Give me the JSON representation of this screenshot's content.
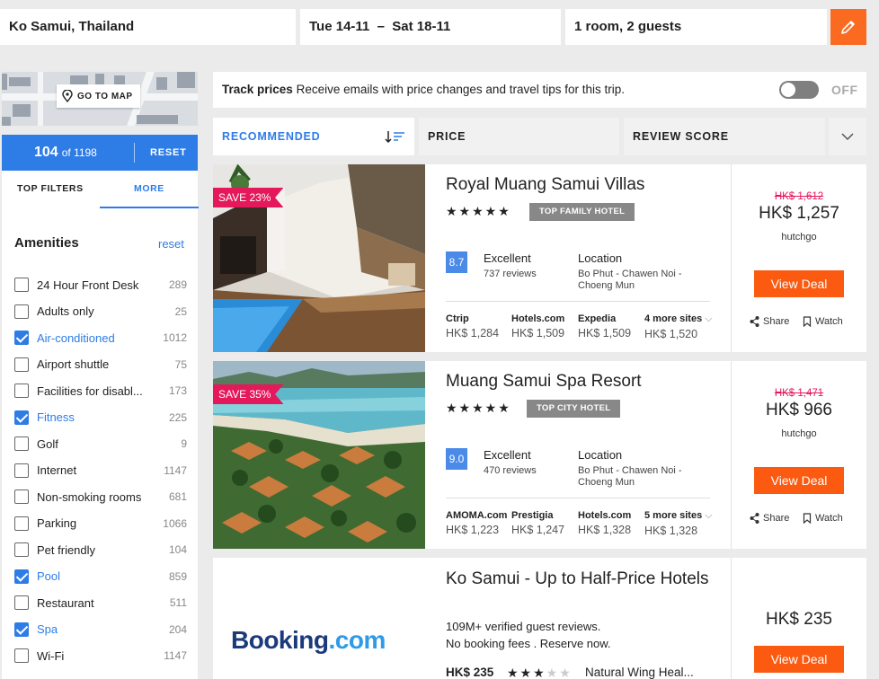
{
  "search": {
    "destination": "Ko Samui, Thailand",
    "date_from": "Tue 14-11",
    "date_sep": "–",
    "date_to": "Sat 18-11",
    "guests": "1 room, 2 guests"
  },
  "map": {
    "label": "GO TO MAP"
  },
  "results": {
    "count": "104",
    "of_total": "of 1198",
    "reset": "RESET"
  },
  "filter_tabs": {
    "top": "TOP FILTERS",
    "more": "MORE"
  },
  "amenities": {
    "title": "Amenities",
    "reset": "reset",
    "items": [
      {
        "label": "24 Hour Front Desk",
        "count": "289",
        "checked": false
      },
      {
        "label": "Adults only",
        "count": "25",
        "checked": false
      },
      {
        "label": "Air-conditioned",
        "count": "1012",
        "checked": true
      },
      {
        "label": "Airport shuttle",
        "count": "75",
        "checked": false
      },
      {
        "label": "Facilities for disabl...",
        "count": "173",
        "checked": false
      },
      {
        "label": "Fitness",
        "count": "225",
        "checked": true
      },
      {
        "label": "Golf",
        "count": "9",
        "checked": false
      },
      {
        "label": "Internet",
        "count": "1147",
        "checked": false
      },
      {
        "label": "Non-smoking rooms",
        "count": "681",
        "checked": false
      },
      {
        "label": "Parking",
        "count": "1066",
        "checked": false
      },
      {
        "label": "Pet friendly",
        "count": "104",
        "checked": false
      },
      {
        "label": "Pool",
        "count": "859",
        "checked": true
      },
      {
        "label": "Restaurant",
        "count": "511",
        "checked": false
      },
      {
        "label": "Spa",
        "count": "204",
        "checked": true
      },
      {
        "label": "Wi-Fi",
        "count": "1147",
        "checked": false
      }
    ]
  },
  "track": {
    "title": "Track prices",
    "text": "Receive emails with price changes and travel tips for this trip.",
    "toggle": "OFF"
  },
  "sort": {
    "recommended": "RECOMMENDED",
    "price": "PRICE",
    "review": "REVIEW SCORE"
  },
  "hotels": [
    {
      "save": "SAVE 23%",
      "name": "Royal Muang Samui Villas",
      "stars": "★★★★★",
      "tag": "TOP FAMILY HOTEL",
      "score": "8.7",
      "rating": "Excellent",
      "reviews": "737 reviews",
      "location_label": "Location",
      "location": "Bo Phut - Chawen Noi - Choeng Mun",
      "sites": [
        {
          "name": "Ctrip",
          "price": "HK$ 1,284"
        },
        {
          "name": "Hotels.com",
          "price": "HK$ 1,509"
        },
        {
          "name": "Expedia",
          "price": "HK$ 1,509"
        },
        {
          "name": "4 more sites",
          "price": "HK$ 1,520"
        }
      ],
      "old_price": "HK$ 1,612",
      "price": "HK$ 1,257",
      "provider": "hutchgo",
      "deal": "View Deal",
      "share": "Share",
      "watch": "Watch"
    },
    {
      "save": "SAVE 35%",
      "name": "Muang Samui Spa Resort",
      "stars": "★★★★★",
      "tag": "TOP CITY HOTEL",
      "score": "9.0",
      "rating": "Excellent",
      "reviews": "470 reviews",
      "location_label": "Location",
      "location": "Bo Phut - Chawen Noi - Choeng Mun",
      "sites": [
        {
          "name": "AMOMA.com",
          "price": "HK$ 1,223"
        },
        {
          "name": "Prestigia",
          "price": "HK$ 1,247"
        },
        {
          "name": "Hotels.com",
          "price": "HK$ 1,328"
        },
        {
          "name": "5 more sites",
          "price": "HK$ 1,328"
        }
      ],
      "old_price": "HK$ 1,471",
      "price": "HK$ 966",
      "provider": "hutchgo",
      "deal": "View Deal",
      "share": "Share",
      "watch": "Watch"
    }
  ],
  "ad": {
    "logo_main": "Booking",
    "logo_suffix": ".com",
    "title": "Ko Samui - Up to Half-Price Hotels",
    "line1": "109M+ verified guest reviews.",
    "line2": "No booking fees . Reserve now.",
    "from_price": "HK$ 235",
    "stars_on": "★★★",
    "stars_off": "★★",
    "area": "Natural Wing Heal...",
    "price": "HK$ 235",
    "deal": "View Deal"
  },
  "colors": {
    "accent": "#2e7ce6",
    "deal": "#fb5a10",
    "save": "#e5185b"
  }
}
